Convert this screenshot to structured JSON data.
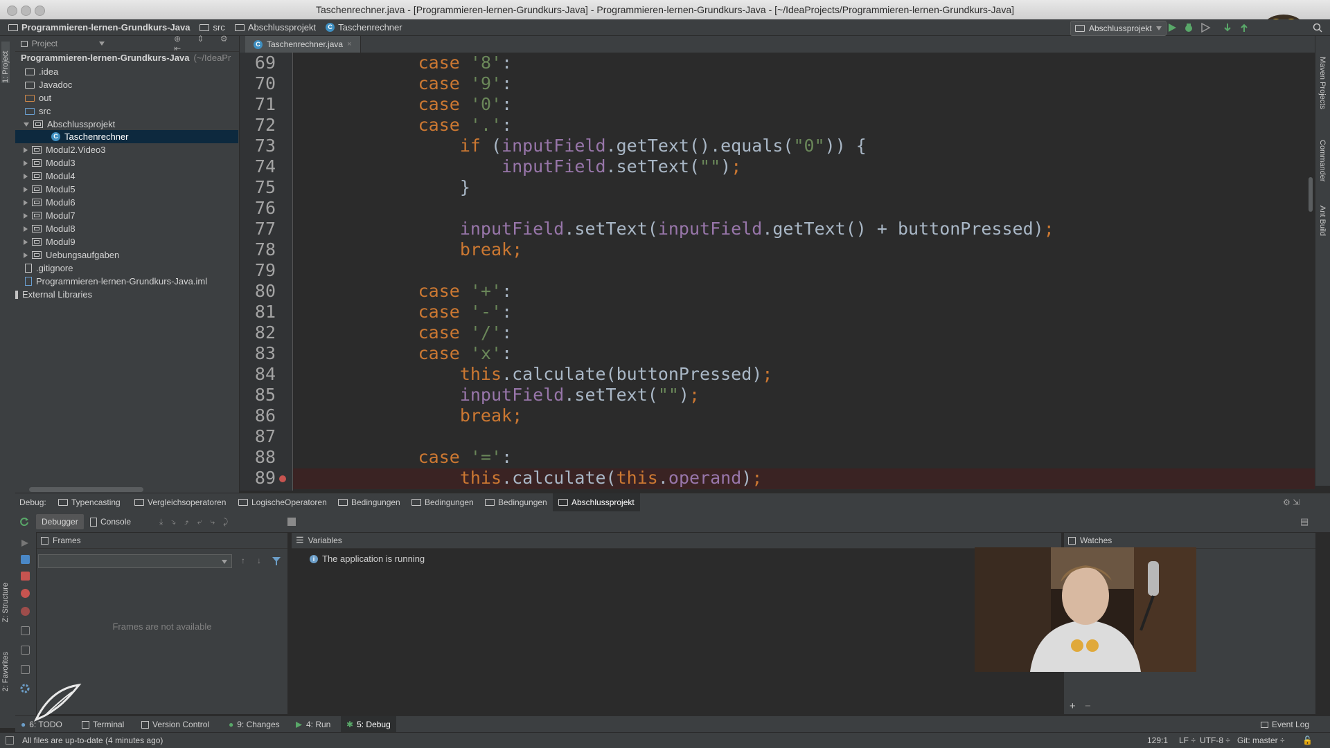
{
  "window": {
    "title": "Taschenrechner.java - [Programmieren-lernen-Grundkurs-Java] - Programmieren-lernen-Grundkurs-Java - [~/IdeaProjects/Programmieren-lernen-Grundkurs-Java]"
  },
  "navbar": {
    "crumbs": [
      "Programmieren-lernen-Grundkurs-Java",
      "src",
      "Abschlussprojekt",
      "Taschenrechner"
    ],
    "run_config": "Abschlussprojekt"
  },
  "sidebar_left": {
    "project_tab": "1: Project",
    "structure_tab": "Z: Structure",
    "favorites_tab": "2: Favorites"
  },
  "sidebar_right": {
    "maven_tab": "Maven Projects",
    "commander_tab": "Commander",
    "ant_tab": "Ant Build"
  },
  "project": {
    "header": "Project",
    "root": "Programmieren-lernen-Grundkurs-Java",
    "root_path": "(~/IdeaPr",
    "items": [
      ".idea",
      "Javadoc",
      "out",
      "src",
      "Abschlussprojekt",
      "Taschenrechner",
      "Modul2.Video3",
      "Modul3",
      "Modul4",
      "Modul5",
      "Modul6",
      "Modul7",
      "Modul8",
      "Modul9",
      "Uebungsaufgaben",
      ".gitignore",
      "Programmieren-lernen-Grundkurs-Java.iml",
      "External Libraries"
    ]
  },
  "editor": {
    "tab": "Taschenrechner.java",
    "line_numbers": [
      "69",
      "70",
      "71",
      "72",
      "73",
      "74",
      "75",
      "76",
      "77",
      "78",
      "79",
      "80",
      "81",
      "82",
      "83",
      "84",
      "85",
      "86",
      "87",
      "88",
      "89"
    ]
  },
  "debug": {
    "label": "Debug:",
    "tabs": [
      "Typencasting",
      "Vergleichsoperatoren",
      "LogischeOperatoren",
      "Bedingungen",
      "Bedingungen",
      "Bedingungen",
      "Abschlussprojekt"
    ],
    "debugger_button": "Debugger",
    "console_button": "Console",
    "frames_title": "Frames",
    "frames_empty": "Frames are not available",
    "variables_title": "Variables",
    "variables_message": "The application is running",
    "watches_title": "Watches",
    "watch_add": "+",
    "watch_remove": "−"
  },
  "tooltabs": {
    "todo": "6: TODO",
    "terminal": "Terminal",
    "vcs": "Version Control",
    "changes": "9: Changes",
    "run": "4: Run",
    "debug": "5: Debug",
    "event_log": "Event Log"
  },
  "status": {
    "message": "All files are up-to-date (4 minutes ago)",
    "position": "129:1",
    "line_sep": "LF ÷",
    "encoding": "UTF-8 ÷",
    "git": "Git: master ÷"
  }
}
